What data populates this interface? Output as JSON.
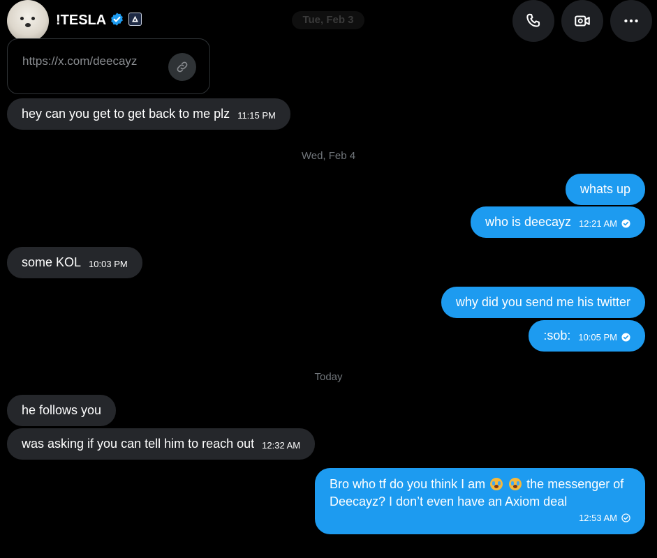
{
  "header": {
    "name": "!TESLA",
    "top_date": "Tue, Feb 3",
    "accent": "#1d9bf0"
  },
  "link_preview": {
    "url": "https://x.com/deecayz"
  },
  "messages": [
    {
      "text": "hey can you get  to get back to me plz",
      "time": "11:15 PM"
    },
    {
      "text": "whats up"
    },
    {
      "text": "who is deecayz",
      "time": "12:21 AM"
    },
    {
      "text": "some KOL",
      "time": "10:03 PM"
    },
    {
      "text": "why did you send me his twitter"
    },
    {
      "text": ":sob:",
      "time": "10:05 PM"
    },
    {
      "text": "he follows you"
    },
    {
      "text": "was asking if you can tell him to reach out",
      "time": "12:32 AM"
    },
    {
      "text_before": "Bro who tf do you think I am",
      "text_after": "the messenger of Deecayz? I don’t even have an Axiom deal",
      "time": "12:53 AM"
    }
  ],
  "dividers": [
    "Wed, Feb 4",
    "Today"
  ],
  "icons": {
    "call": "phone-icon",
    "video": "video-camera-icon",
    "more": "more-dots-icon",
    "link": "link-icon",
    "verified": "verified-badge-icon",
    "read": "read-check-icon"
  }
}
